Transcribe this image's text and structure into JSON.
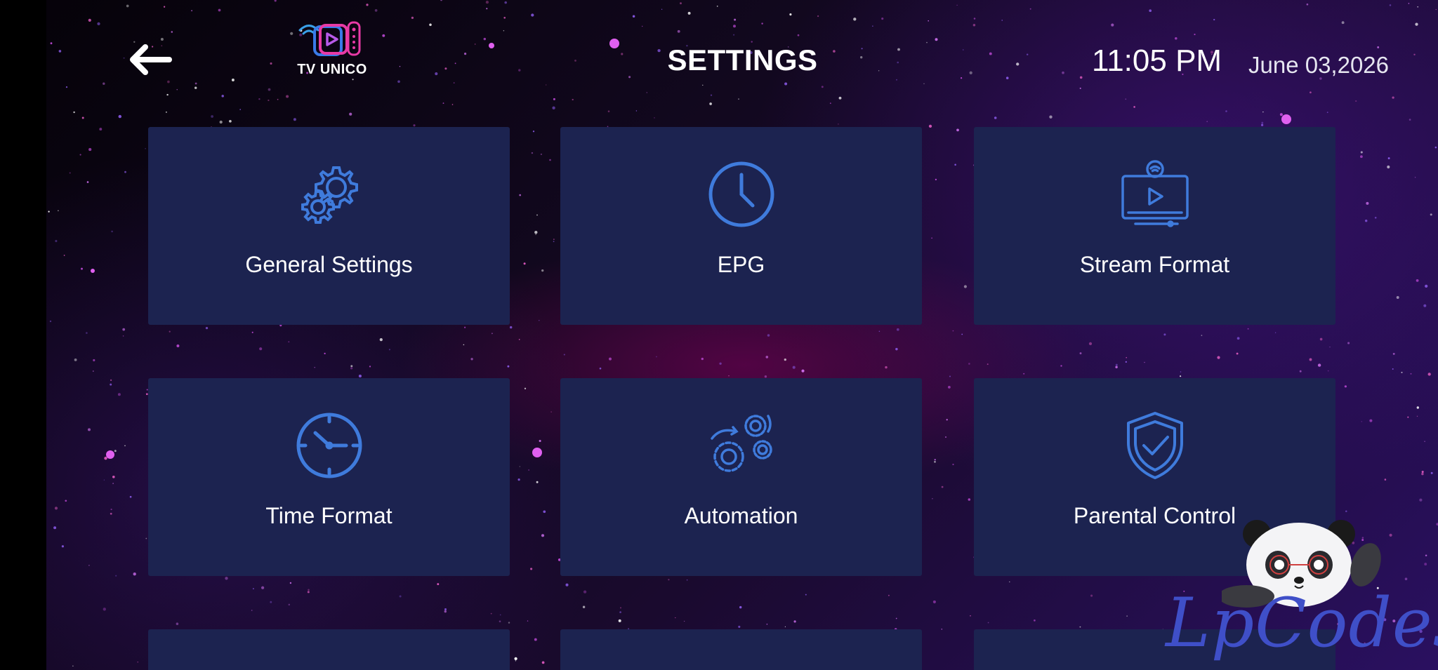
{
  "header": {
    "title": "SETTINGS",
    "time": "11:05 PM",
    "date": "June 03,2026",
    "logo_text": "TV UNICO"
  },
  "tiles": [
    {
      "label": "General Settings",
      "icon": "gears-icon"
    },
    {
      "label": "EPG",
      "icon": "clock-icon"
    },
    {
      "label": "Stream Format",
      "icon": "stream-screen-icon"
    },
    {
      "label": "Time Format",
      "icon": "time-format-clock-icon"
    },
    {
      "label": "Automation",
      "icon": "automation-gears-icon"
    },
    {
      "label": "Parental Control",
      "icon": "shield-check-icon"
    }
  ],
  "watermark": {
    "text": "LpCodes"
  },
  "colors": {
    "tile_bg": "#1c2350",
    "icon_blue": "#3f7bdc",
    "watermark_blue": "#3f4fc8"
  }
}
